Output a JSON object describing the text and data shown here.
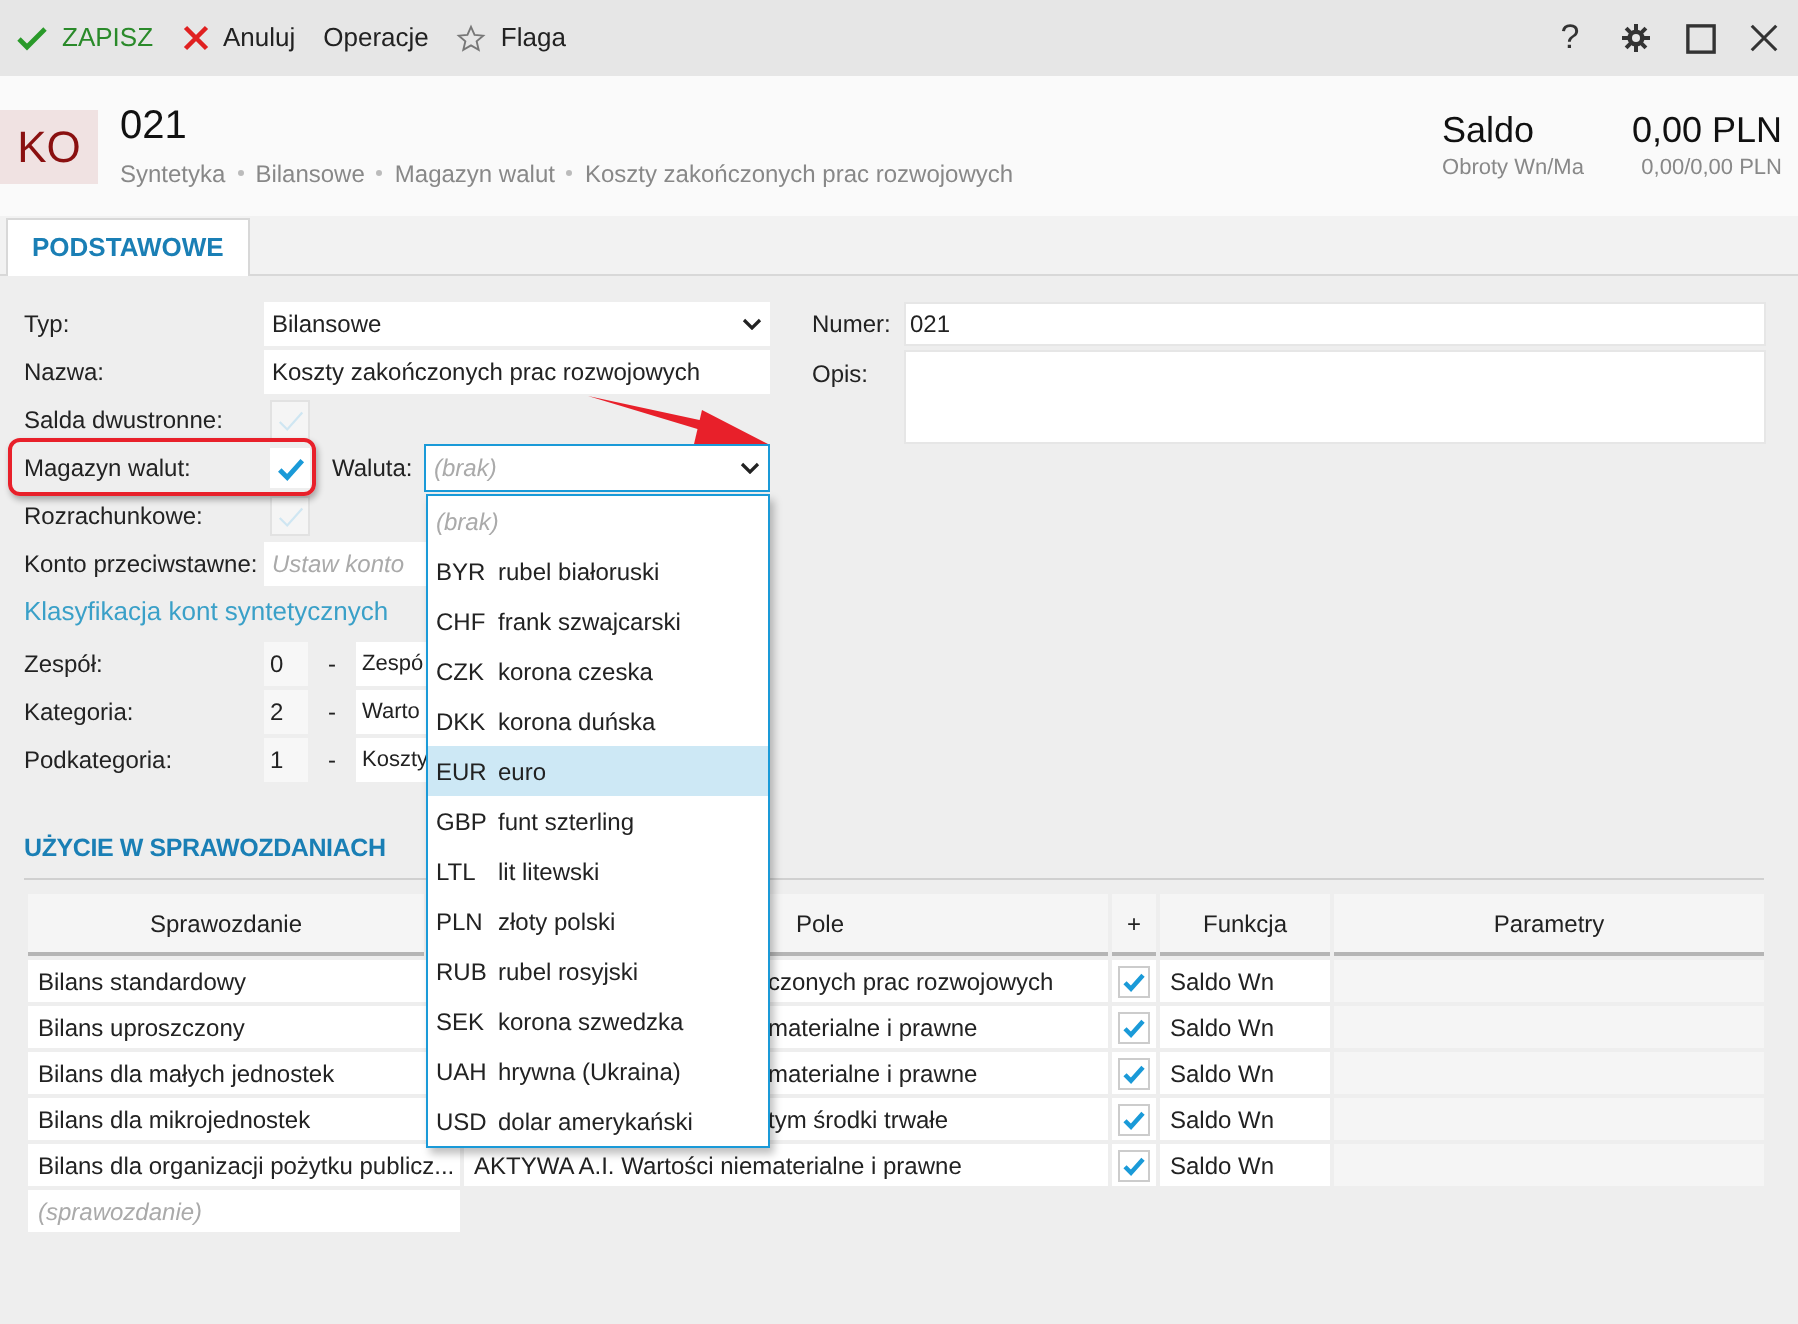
{
  "toolbar": {
    "actions": [
      {
        "kind": "save",
        "label": "ZAPISZ"
      },
      {
        "kind": "cancel",
        "label": "Anuluj"
      },
      {
        "kind": "plain",
        "label": "Operacje"
      },
      {
        "kind": "flag",
        "label": "Flaga"
      }
    ],
    "help_label": "?"
  },
  "header": {
    "badge": "KO",
    "number": "021",
    "breadcrumb": [
      "Syntetyka",
      "Bilansowe",
      "Magazyn walut",
      "Koszty zakończonych prac rozwojowych"
    ],
    "balance_label": "Saldo",
    "balance_value": "0,00 PLN",
    "turnover_label": "Obroty Wn/Ma",
    "turnover_value": "0,00/0,00 PLN"
  },
  "tabs": [
    {
      "label": "PODSTAWOWE",
      "selected": true
    }
  ],
  "form": {
    "typ": {
      "label": "Typ:",
      "value": "Bilansowe"
    },
    "nazwa": {
      "label": "Nazwa:",
      "value": "Koszty zakończonych prac rozwojowych"
    },
    "salda": {
      "label": "Salda dwustronne:",
      "checked": false
    },
    "magazyn": {
      "label": "Magazyn walut:",
      "checked": true,
      "highlighted": true
    },
    "waluta": {
      "label": "Waluta:",
      "placeholder": "(brak)",
      "expanded": true
    },
    "rozrachunkowe": {
      "label": "Rozrachunkowe:",
      "checked": false
    },
    "konto": {
      "label": "Konto przeciwstawne:",
      "placeholder": "Ustaw konto"
    },
    "classification_link": "Klasyfikacja kont syntetycznych",
    "classification": [
      {
        "label": "Zespół:",
        "code": "0",
        "separator": "-",
        "name": "Zespó"
      },
      {
        "label": "Kategoria:",
        "code": "2",
        "separator": "-",
        "name": "Warto"
      },
      {
        "label": "Podkategoria:",
        "code": "1",
        "separator": "-",
        "name": "Koszty"
      }
    ],
    "numer": {
      "label": "Numer:",
      "value": "021"
    },
    "opis": {
      "label": "Opis:"
    }
  },
  "currency_dropdown": {
    "items": [
      {
        "kind": "none",
        "label": "(brak)",
        "selected": false
      },
      {
        "kind": "currency",
        "code": "BYR",
        "name": "rubel białoruski",
        "selected": false
      },
      {
        "kind": "currency",
        "code": "CHF",
        "name": "frank szwajcarski",
        "selected": false
      },
      {
        "kind": "currency",
        "code": "CZK",
        "name": "korona czeska",
        "selected": false
      },
      {
        "kind": "currency",
        "code": "DKK",
        "name": "korona duńska",
        "selected": false
      },
      {
        "kind": "currency",
        "code": "EUR",
        "name": "euro",
        "selected": true
      },
      {
        "kind": "currency",
        "code": "GBP",
        "name": "funt szterling",
        "selected": false
      },
      {
        "kind": "currency",
        "code": "LTL",
        "name": "lit litewski",
        "selected": false
      },
      {
        "kind": "currency",
        "code": "PLN",
        "name": "złoty polski",
        "selected": false
      },
      {
        "kind": "currency",
        "code": "RUB",
        "name": "rubel rosyjski",
        "selected": false
      },
      {
        "kind": "currency",
        "code": "SEK",
        "name": "korona szwedzka",
        "selected": false
      },
      {
        "kind": "currency",
        "code": "UAH",
        "name": "hrywna (Ukraina)",
        "selected": false
      },
      {
        "kind": "currency",
        "code": "USD",
        "name": "dolar amerykański",
        "selected": false
      }
    ]
  },
  "usage": {
    "title": "UŻYCIE W SPRAWOZDANIACH",
    "columns": [
      "Sprawozdanie",
      "Pole",
      "+",
      "Funkcja",
      "Parametry"
    ],
    "rows": [
      {
        "report": "Bilans standardowy",
        "field": "czonych prac rozwojowych",
        "included": true,
        "function": "Saldo Wn"
      },
      {
        "report": "Bilans uproszczony",
        "field": "materialne i prawne",
        "included": true,
        "function": "Saldo Wn"
      },
      {
        "report": "Bilans dla małych jednostek",
        "field": "materialne i prawne",
        "included": true,
        "function": "Saldo Wn"
      },
      {
        "report": "Bilans dla mikrojednostek",
        "field": "tym środki trwałe",
        "included": true,
        "function": "Saldo Wn"
      },
      {
        "report": "Bilans dla organizacji pożytku publicz...",
        "field": "AKTYWA A.I. Wartości niematerialne i prawne",
        "included": true,
        "function": "Saldo Wn"
      }
    ],
    "new_row_placeholder": "(sprawozdanie)"
  }
}
